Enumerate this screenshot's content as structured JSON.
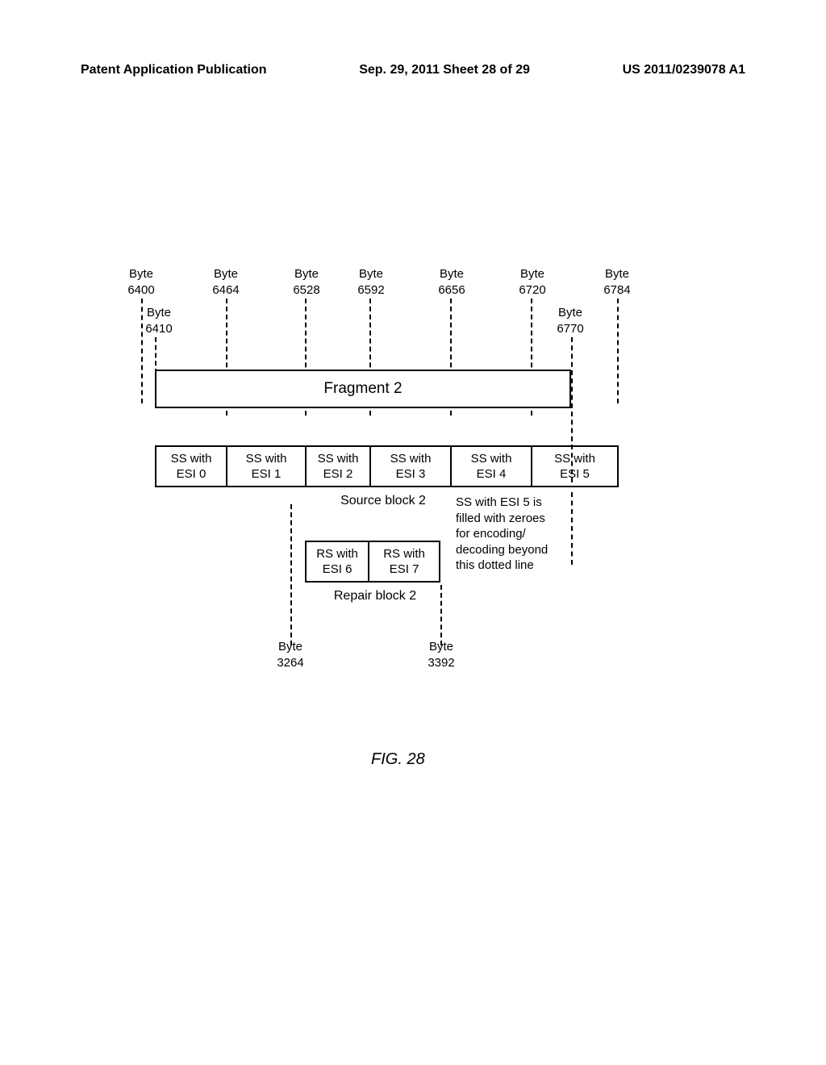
{
  "header": {
    "left": "Patent Application Publication",
    "center": "Sep. 29, 2011  Sheet 28 of 29",
    "right": "US 2011/0239078 A1"
  },
  "byte_labels": {
    "b6400": "Byte\n6400",
    "b6410": "Byte\n6410",
    "b6464": "Byte\n6464",
    "b6528": "Byte\n6528",
    "b6592": "Byte\n6592",
    "b6656": "Byte\n6656",
    "b6720": "Byte\n6720",
    "b6770": "Byte\n6770",
    "b6784": "Byte\n6784",
    "b3264": "Byte\n3264",
    "b3392": "Byte\n3392"
  },
  "fragment": "Fragment 2",
  "source_cells": [
    "SS with\nESI 0",
    "SS with\nESI 1",
    "SS with\nESI 2",
    "SS with\nESI 3",
    "SS with\nESI 4",
    "SS with\nESI 5"
  ],
  "source_block_label": "Source block 2",
  "note": "SS with ESI 5 is\nfilled with zeroes\nfor encoding/\ndecoding beyond\nthis dotted line",
  "repair_cells": [
    "RS with\nESI 6",
    "RS with\nESI 7"
  ],
  "repair_block_label": "Repair block 2",
  "figure_label": "FIG. 28"
}
